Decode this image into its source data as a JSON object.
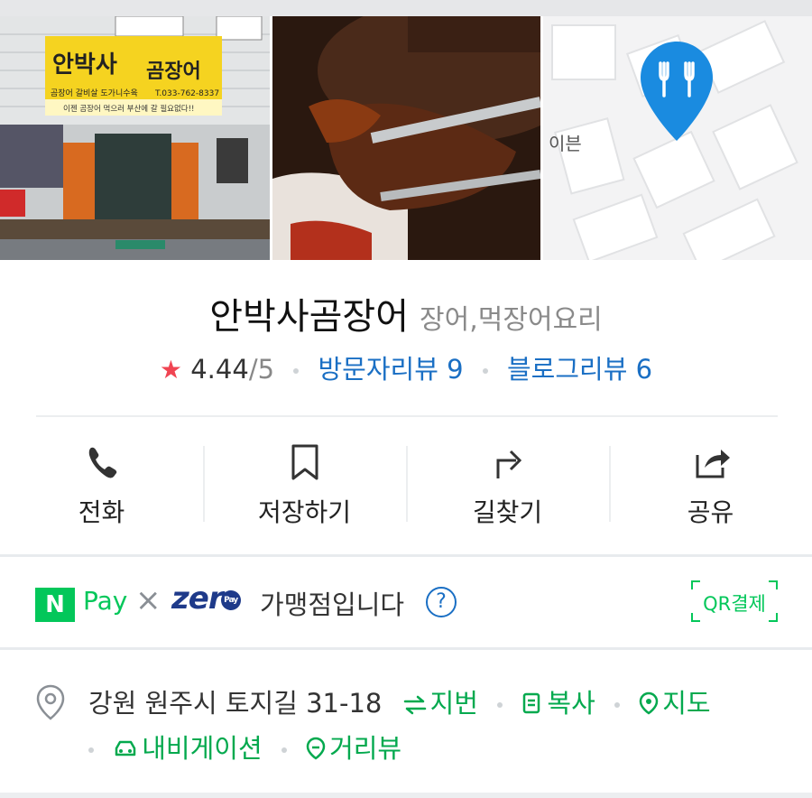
{
  "photos": [
    {
      "name": "storefront-photo",
      "sign_lines": [
        "안박사",
        "곰장어",
        "곰장어 갈비살 도가니수육",
        "T.033-762-8337",
        "이젠 곰장어 먹으러 부산에 갈 필요없다!!"
      ]
    },
    {
      "name": "food-photo"
    },
    {
      "name": "map-thumbnail",
      "map_label": "이븐",
      "pin_icon": "fork-knife-icon",
      "pin_color": "#1a8be0"
    }
  ],
  "place": {
    "name": "안박사곰장어",
    "category": "장어,먹장어요리"
  },
  "rating": {
    "score": "4.44",
    "out_of": "/5",
    "visitor_reviews": "방문자리뷰 9",
    "blog_reviews": "블로그리뷰 6"
  },
  "actions": [
    {
      "label": "전화",
      "icon": "phone-icon"
    },
    {
      "label": "저장하기",
      "icon": "bookmark-icon"
    },
    {
      "label": "길찾기",
      "icon": "directions-icon"
    },
    {
      "label": "공유",
      "icon": "share-icon"
    }
  ],
  "payment": {
    "n_logo": "N",
    "pay_text": "Pay",
    "cross": "×",
    "zero_text": "zer",
    "zero_pay": "Pay",
    "member_text": "가맹점입니다",
    "help": "?",
    "qr_label": "QR결제",
    "brand_color": "#03c75a"
  },
  "address": {
    "text": "강원 원주시 토지길 31-18",
    "links": {
      "jibun": "지번",
      "copy": "복사",
      "map": "지도",
      "navigation": "내비게이션",
      "roadview": "거리뷰"
    }
  },
  "colors": {
    "link_blue": "#1a6fc4",
    "link_green": "#03a94e",
    "star_red": "#f04452"
  }
}
